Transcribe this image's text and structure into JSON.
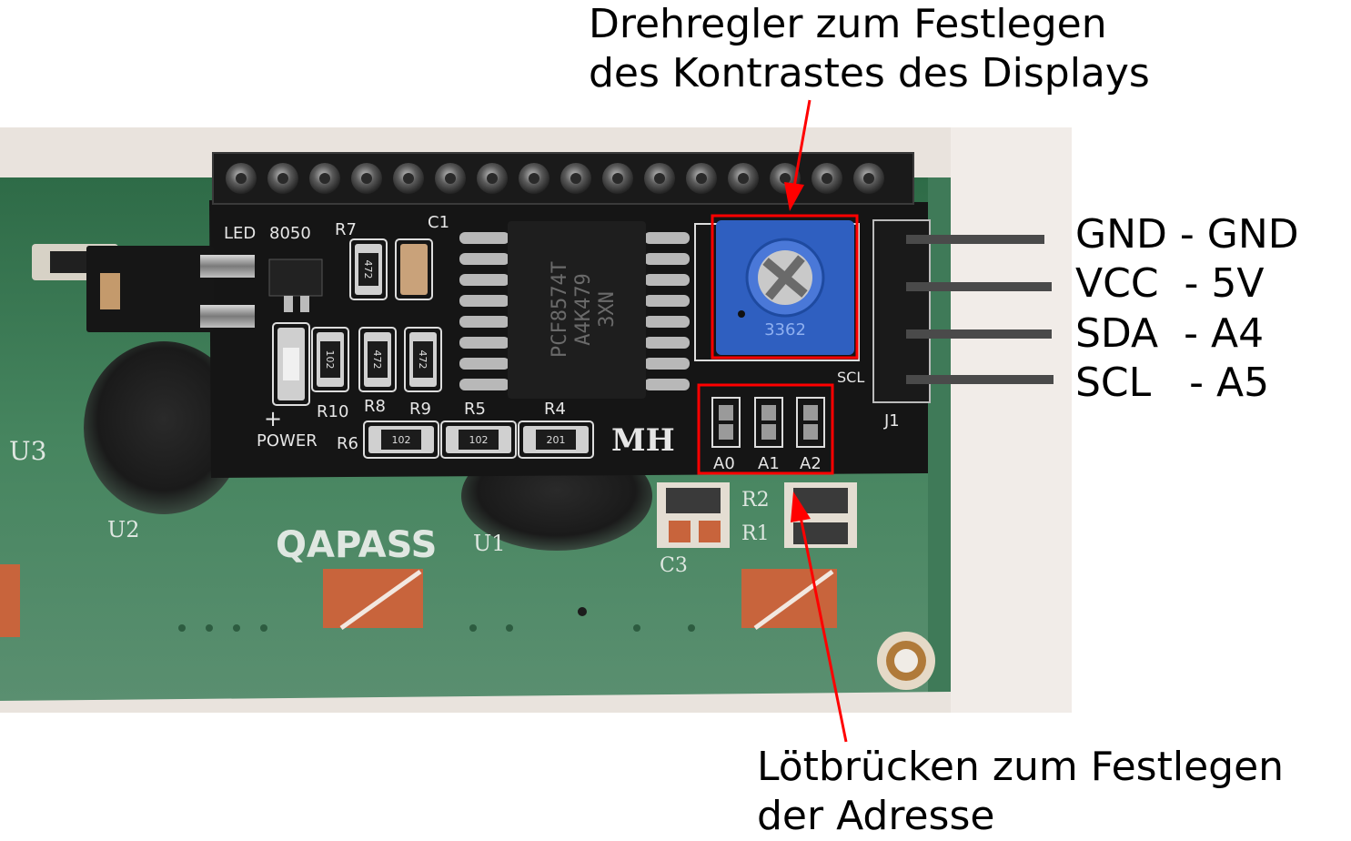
{
  "callouts": {
    "potentiometer_line1": "Drehregler zum Festlegen",
    "potentiometer_line2": "des Kontrastes des Displays",
    "solder_bridges_line1": "Lötbrücken zum Festlegen",
    "solder_bridges_line2": "der Adresse"
  },
  "pin_mapping": [
    {
      "text": "GND - GND"
    },
    {
      "text": "VCC  - 5V"
    },
    {
      "text": "SDA  - A4"
    },
    {
      "text": "SCL   - A5"
    }
  ],
  "board_silkscreen": {
    "led": "LED",
    "transistor": "8050",
    "r7": "R7",
    "c1": "C1",
    "r10": "R10",
    "r8": "R8",
    "r9": "R9",
    "r5": "R5",
    "r4": "R4",
    "r6": "R6",
    "power_plus": "+",
    "power": "POWER",
    "brand": "MH",
    "a0": "A0",
    "a1": "A1",
    "a2": "A2",
    "j1": "J1",
    "pin_gnd": "GND",
    "pin_vcc": "VCC",
    "pin_sda": "SDA",
    "pin_scl": "SCL",
    "chip_line1": "PCF8574T",
    "chip_line2": "A4K479",
    "chip_line3": "3XN",
    "pot_code": "3362",
    "smd_102": "102",
    "smd_472": "472",
    "smd_201": "201"
  },
  "lcd_silkscreen": {
    "qapass": "QAPASS",
    "u1": "U1",
    "u2": "U2",
    "u3": "U3",
    "r1": "R1",
    "r2": "R2",
    "c3": "C3"
  },
  "colors": {
    "lcd_pcb": "#3d7a55",
    "i2c_pcb": "#141414",
    "potentiometer": "#2f5fc0",
    "highlight": "#ff0000"
  }
}
